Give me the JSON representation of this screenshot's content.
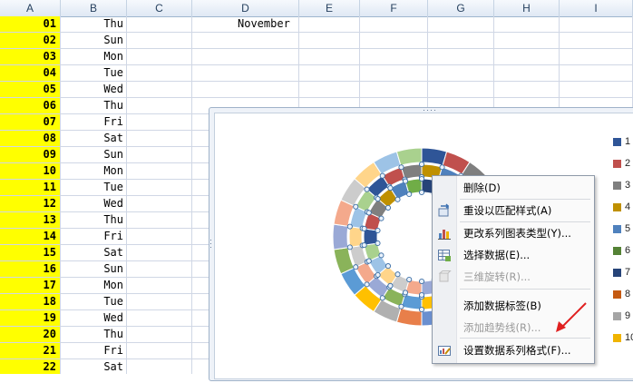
{
  "columns": [
    "A",
    "B",
    "C",
    "D",
    "E",
    "F",
    "G",
    "H",
    "I"
  ],
  "rows": [
    {
      "a": "01",
      "b": "Thu",
      "d": "November"
    },
    {
      "a": "02",
      "b": "Sun",
      "d": ""
    },
    {
      "a": "03",
      "b": "Mon",
      "d": ""
    },
    {
      "a": "04",
      "b": "Tue",
      "d": ""
    },
    {
      "a": "05",
      "b": "Wed",
      "d": ""
    },
    {
      "a": "06",
      "b": "Thu",
      "d": ""
    },
    {
      "a": "07",
      "b": "Fri",
      "d": ""
    },
    {
      "a": "08",
      "b": "Sat",
      "d": ""
    },
    {
      "a": "09",
      "b": "Sun",
      "d": ""
    },
    {
      "a": "10",
      "b": "Mon",
      "d": ""
    },
    {
      "a": "11",
      "b": "Tue",
      "d": ""
    },
    {
      "a": "12",
      "b": "Wed",
      "d": ""
    },
    {
      "a": "13",
      "b": "Thu",
      "d": ""
    },
    {
      "a": "14",
      "b": "Fri",
      "d": ""
    },
    {
      "a": "15",
      "b": "Sat",
      "d": ""
    },
    {
      "a": "16",
      "b": "Sun",
      "d": ""
    },
    {
      "a": "17",
      "b": "Mon",
      "d": ""
    },
    {
      "a": "18",
      "b": "Tue",
      "d": ""
    },
    {
      "a": "19",
      "b": "Wed",
      "d": ""
    },
    {
      "a": "20",
      "b": "Thu",
      "d": ""
    },
    {
      "a": "21",
      "b": "Fri",
      "d": ""
    },
    {
      "a": "22",
      "b": "Sat",
      "d": ""
    }
  ],
  "chart": {
    "type": "doughnut",
    "ring_colors": [
      "#2f5597",
      "#c0504d",
      "#7f7f7f",
      "#bf9000",
      "#4f81bd",
      "#70ad47",
      "#264478",
      "#9e480e",
      "#a5a5a5",
      "#f0b400",
      "#6a8fcf",
      "#e87f4a",
      "#b0b0b0",
      "#ffc000",
      "#5b9bd5",
      "#8ab35a",
      "#9aa9d6",
      "#f4a98c",
      "#cccccc",
      "#ffd58a",
      "#9dc3e6",
      "#a9d18e"
    ],
    "legend": [
      {
        "label": "1",
        "color": "#2f5597"
      },
      {
        "label": "2",
        "color": "#c0504d"
      },
      {
        "label": "3",
        "color": "#7f7f7f"
      },
      {
        "label": "4",
        "color": "#bf9000"
      },
      {
        "label": "5",
        "color": "#4f81bd"
      },
      {
        "label": "6",
        "color": "#548235"
      },
      {
        "label": "7",
        "color": "#264478"
      },
      {
        "label": "8",
        "color": "#c55a11"
      },
      {
        "label": "9",
        "color": "#a5a5a5"
      },
      {
        "label": "10",
        "color": "#f0b400"
      }
    ]
  },
  "context_menu": {
    "items": [
      {
        "label": "删除(D)",
        "icon": "none",
        "disabled": false
      },
      {
        "label": "重设以匹配样式(A)",
        "icon": "reset-style-icon",
        "disabled": false
      },
      {
        "label": "更改系列图表类型(Y)...",
        "icon": "chart-type-icon",
        "disabled": false
      },
      {
        "label": "选择数据(E)...",
        "icon": "select-data-icon",
        "disabled": false
      },
      {
        "label": "三维旋转(R)...",
        "icon": "rotation-3d-icon",
        "disabled": true
      },
      {
        "label": "添加数据标签(B)",
        "icon": "none",
        "disabled": false
      },
      {
        "label": "添加趋势线(R)...",
        "icon": "none",
        "disabled": true
      },
      {
        "label": "设置数据系列格式(F)...",
        "icon": "format-series-icon",
        "disabled": false
      }
    ]
  },
  "annotation": {
    "arrow_color": "#e02020"
  }
}
